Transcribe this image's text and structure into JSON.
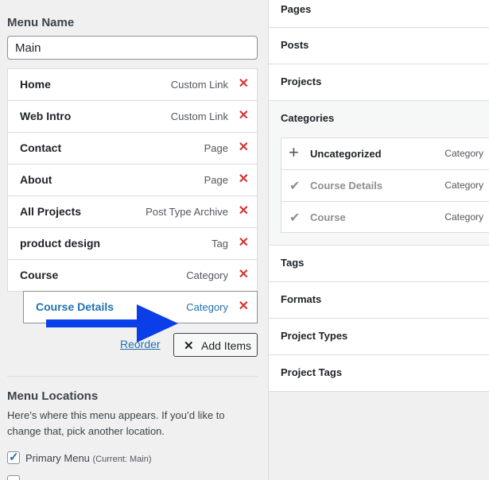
{
  "menu_name": {
    "label": "Menu Name",
    "value": "Main"
  },
  "menu_items": [
    {
      "title": "Home",
      "type": "Custom Link"
    },
    {
      "title": "Web Intro",
      "type": "Custom Link"
    },
    {
      "title": "Contact",
      "type": "Page"
    },
    {
      "title": "About",
      "type": "Page"
    },
    {
      "title": "All Projects",
      "type": "Post Type Archive"
    },
    {
      "title": "product design",
      "type": "Tag"
    },
    {
      "title": "Course",
      "type": "Category"
    },
    {
      "title": "Course Details",
      "type": "Category"
    }
  ],
  "actions": {
    "reorder": "Reorder",
    "add_items": "Add Items",
    "delete_glyph": "✕"
  },
  "locations": {
    "title": "Menu Locations",
    "description": "Here’s where this menu appears. If you’d like to change that, pick another location.",
    "primary_label": "Primary Menu",
    "primary_current": "(Current: Main)",
    "primary_checked": true
  },
  "sources": {
    "pages": "Pages",
    "posts": "Posts",
    "projects": "Projects",
    "categories": "Categories",
    "tags": "Tags",
    "formats": "Formats",
    "project_types": "Project Types",
    "project_tags": "Project Tags"
  },
  "category_list": [
    {
      "name": "Uncategorized",
      "type": "Category",
      "state": "add"
    },
    {
      "name": "Course Details",
      "type": "Category",
      "state": "added"
    },
    {
      "name": "Course",
      "type": "Category",
      "state": "added"
    }
  ],
  "colors": {
    "accent": "#2271b1",
    "delete": "#d63638",
    "arrow": "#0a3ee8"
  },
  "icons": {
    "arrow": "right-arrow-icon",
    "add": "plus-icon",
    "added": "checkmark-icon"
  }
}
